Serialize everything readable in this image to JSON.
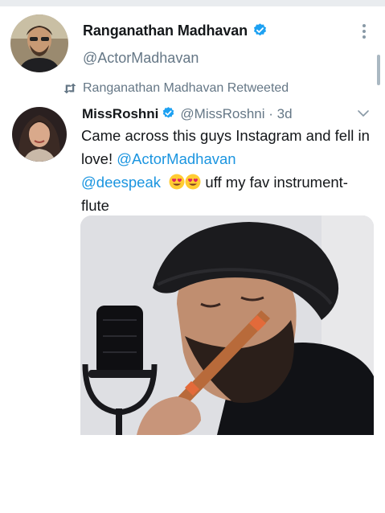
{
  "profile": {
    "name": "Ranganathan Madhavan",
    "handle": "@ActorMadhavan",
    "avatar_icon": "person-avatar",
    "verified_icon": "verified-badge-icon",
    "menu_icon": "more-vertical-icon"
  },
  "retweet": {
    "icon": "retweet-icon",
    "text": "Ranganathan Madhavan Retweeted"
  },
  "tweet": {
    "author_name": "MissRoshni",
    "author_handle": "@MissRoshni",
    "separator": "·",
    "time": "3d",
    "text_1": "Came across this guys Instagram and fell in love! ",
    "mention_1": "@ActorMadhavan",
    "mention_2": "@deespeak",
    "text_2": " uff my fav instrument- flute",
    "emojis": [
      "heart-eyes-emoji",
      "heart-eyes-emoji"
    ],
    "media_description_icon": "photo-flute-player"
  },
  "colors": {
    "accent": "#1da1f2",
    "mention": "#1b95e0",
    "muted": "#657786",
    "text": "#14171a"
  }
}
